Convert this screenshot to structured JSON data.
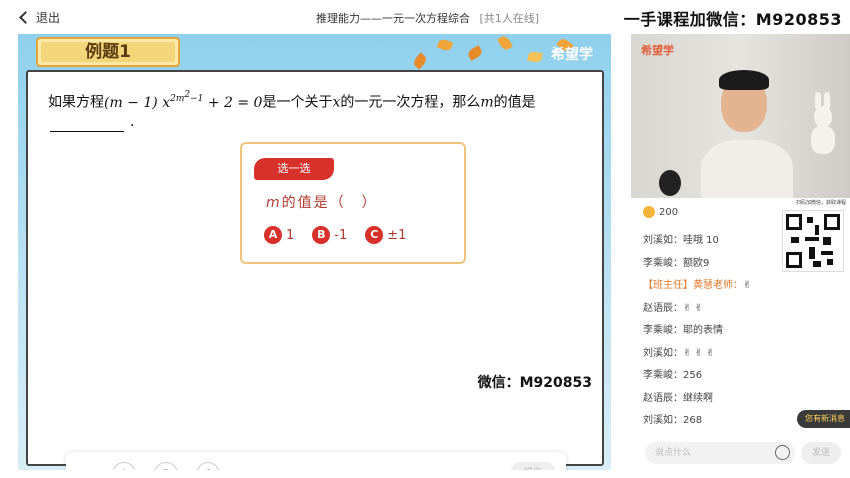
{
  "topbar": {
    "back_label": "退出",
    "title": "推理能力——一元一次方程综合",
    "online": "[共1人在线]",
    "watermark": "一手课程加微信：M920853"
  },
  "slide": {
    "badge": "例题1",
    "brand": "希望学",
    "question_prefix": "如果方程",
    "question_suffix": "是一个关于",
    "question_var_x": "x",
    "question_mid": "的一元一次方程，那么",
    "question_var_m": "m",
    "question_end": "的值是",
    "period": ".",
    "choice_tag": "选一选",
    "choice_ask": "的值是（　）",
    "choice_ask_var": "m",
    "options": [
      {
        "letter": "A",
        "value": "1"
      },
      {
        "letter": "B",
        "value": "-1"
      },
      {
        "letter": "C",
        "value": "±1"
      }
    ],
    "wechat": "微信：M920853"
  },
  "answer_bar": {
    "collapse": "«",
    "buttons": [
      "A",
      "B",
      "C"
    ],
    "submit": "提交"
  },
  "side": {
    "video_logo": "希望学",
    "coins": "200",
    "qr_caption": "扫码加微信，获取课程",
    "chat": [
      {
        "user": "刘溪如：",
        "text": "哇哦 10"
      },
      {
        "user": "李乘峻：",
        "text": "额欧9"
      },
      {
        "user": "【班主任】黄慧老师：",
        "text": "✌"
      },
      {
        "user": "赵语辰：",
        "text": "✌ ✌"
      },
      {
        "user": "李乘峻：",
        "text": "耶的表情"
      },
      {
        "user": "刘溪如：",
        "text": "✌ ✌ ✌"
      },
      {
        "user": "李乘峻：",
        "text": "256"
      },
      {
        "user": "赵语辰：",
        "text": "继续啊"
      },
      {
        "user": "刘溪如：",
        "text": "268"
      }
    ],
    "new_msg": "您有新消息",
    "input_placeholder": "说点什么",
    "send": "发送"
  }
}
